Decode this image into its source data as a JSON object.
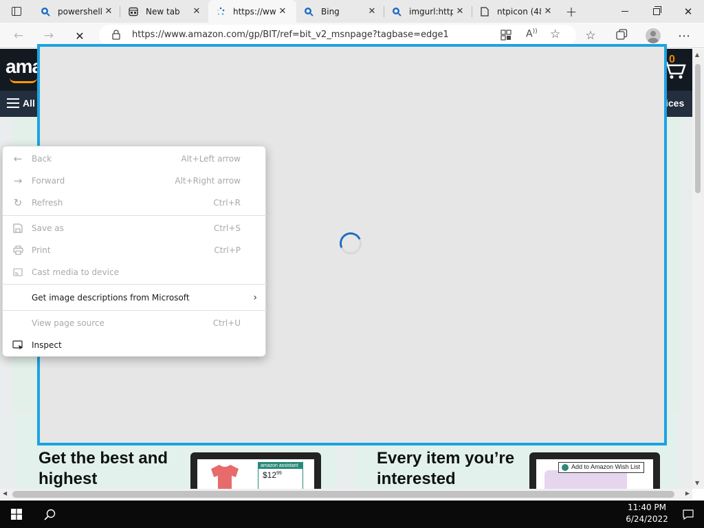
{
  "tabs": [
    {
      "title": "powershell",
      "icon": "search-icon"
    },
    {
      "title": "New tab",
      "icon": "new-tab-icon"
    },
    {
      "title": "https://www",
      "icon": "loading-icon",
      "active": true
    },
    {
      "title": "Bing",
      "icon": "search-icon"
    },
    {
      "title": "imgurl:http",
      "icon": "search-icon"
    },
    {
      "title": "ntpicon (48",
      "icon": "page-icon"
    }
  ],
  "address_bar": {
    "url": "https://www.amazon.com/gp/BIT/ref=bit_v2_msnpage?tagbase=edge1"
  },
  "amazon": {
    "logo": "ama",
    "cart_count": "0",
    "nav_all": "All",
    "nav_right": "ices",
    "card1_heading": "Get the best and highest",
    "card2_heading": "Every item you’re interested",
    "card1_badge": "amazon assistant",
    "card1_price": "$12",
    "card1_cents": "99",
    "card2_wishlist": "Add to Amazon Wish List"
  },
  "context_menu": {
    "items": [
      {
        "label": "Back",
        "shortcut": "Alt+Left arrow",
        "enabled": false,
        "icon": "back-arrow-icon"
      },
      {
        "label": "Forward",
        "shortcut": "Alt+Right arrow",
        "enabled": false,
        "icon": "forward-arrow-icon"
      },
      {
        "label": "Refresh",
        "shortcut": "Ctrl+R",
        "enabled": false,
        "icon": "refresh-icon"
      },
      {
        "label": "Save as",
        "shortcut": "Ctrl+S",
        "enabled": false,
        "icon": "save-icon"
      },
      {
        "label": "Print",
        "shortcut": "Ctrl+P",
        "enabled": false,
        "icon": "print-icon"
      },
      {
        "label": "Cast media to device",
        "shortcut": "",
        "enabled": false,
        "icon": "cast-icon"
      },
      {
        "label": "Get image descriptions from Microsoft",
        "shortcut": "",
        "enabled": true,
        "icon": ""
      },
      {
        "label": "View page source",
        "shortcut": "Ctrl+U",
        "enabled": false,
        "icon": ""
      },
      {
        "label": "Inspect",
        "shortcut": "",
        "enabled": true,
        "icon": "inspect-icon"
      }
    ]
  },
  "taskbar": {
    "time": "11:40 PM",
    "date": "6/24/2022"
  },
  "colors": {
    "capture_border": "#1aa3e2",
    "amazon_header": "#131921",
    "amazon_nav": "#232f3e",
    "spinner": "#1e6cc4"
  }
}
